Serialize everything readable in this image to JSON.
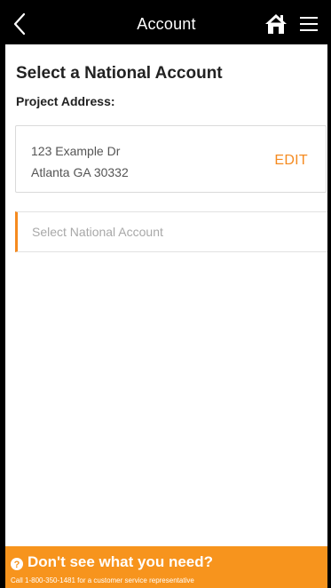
{
  "navbar": {
    "title": "Account",
    "back_icon": "chevron-left-icon",
    "home_icon": "home-icon",
    "menu_icon": "hamburger-menu-icon"
  },
  "main": {
    "title": "Select a National Account",
    "section_label": "Project Address:",
    "address": {
      "line1": "123 Example Dr",
      "line2": "Atlanta GA 30332",
      "edit_label": "EDIT"
    },
    "select": {
      "placeholder": "Select National Account"
    }
  },
  "footer": {
    "icon": "question-circle-icon",
    "title": "Don't see what you need?",
    "subtitle": "Call 1-800-350-1481 for a customer service representative"
  },
  "colors": {
    "accent": "#f58a1f",
    "footer_bg": "#f7941d",
    "navbar_bg": "#000000"
  }
}
